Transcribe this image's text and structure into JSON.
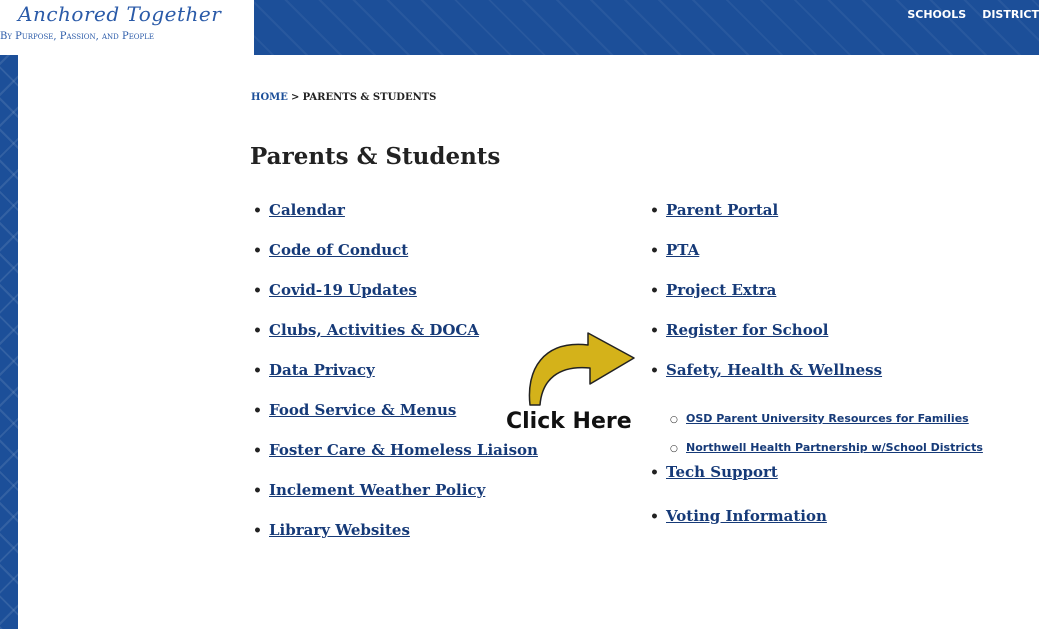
{
  "header": {
    "logo_title": "Anchored Together",
    "logo_tagline": "By Purpose, Passion, and People",
    "nav": [
      "SCHOOLS",
      "DISTRICT"
    ]
  },
  "breadcrumb": {
    "home": "HOME",
    "separator": ">",
    "current": "PARENTS & STUDENTS"
  },
  "page_title": "Parents & Students",
  "left_links": [
    "Calendar",
    "Code of Conduct",
    "Covid-19 Updates",
    "Clubs, Activities & DOCA",
    "Data Privacy",
    "Food Service & Menus",
    "Foster Care & Homeless Liaison",
    "Inclement Weather Policy",
    "Library Websites"
  ],
  "right_links": [
    "Parent Portal",
    "PTA",
    "Project Extra",
    "Register for School",
    "Safety, Health & Wellness"
  ],
  "safety_sublinks": [
    "OSD Parent University Resources for Families",
    "Northwell Health Partnership w/School Districts"
  ],
  "right_links_after": [
    "Tech Support",
    "Voting Information"
  ],
  "callout": {
    "text": "Click Here",
    "arrow_color": "#d4b21a"
  },
  "colors": {
    "header_bg": "#1c4f99",
    "link": "#163a78"
  }
}
